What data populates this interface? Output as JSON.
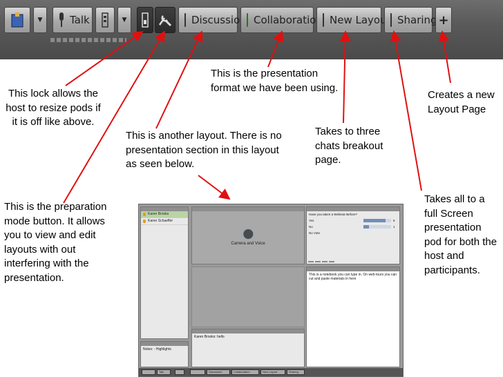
{
  "toolbar": {
    "talk_label": "Talk",
    "tabs": [
      "Discussion",
      "Collaboration",
      "New Layout",
      "Sharing"
    ],
    "active_tab": "Collaboration",
    "add_symbol": "+",
    "icons": {
      "user": "user-icon",
      "mic": "microphone-icon",
      "cam": "camera-icon",
      "lock": "lock-icon",
      "prep": "preparation-mode-icon",
      "dropdown": "dropdown-arrow-icon",
      "add": "plus-icon"
    },
    "colors": {
      "active_indicator": "#3fd13a",
      "toolbar_bg": "#5a5a5a"
    }
  },
  "callouts": {
    "lock": "This lock allows the host to resize pods if it is off like above.",
    "prep": "This is the preparation mode button.  It allows you to view and edit layouts with out interfering with the presentation.",
    "discussion": "This is another layout.  There is no presentation section in this layout as seen below.",
    "collaboration": "This is the presentation format we have been using.",
    "new_layout": "Takes to three chats breakout page.",
    "sharing": "Takes all to a full Screen presentation pod for both the host and participants.",
    "add": "Creates a new Layout Page"
  },
  "screenshot": {
    "attendees": [
      "Karen Brooks",
      "Karen Schaeffer"
    ],
    "camera_label": "Camera and Voice",
    "poll_question": "Have you taken a Webinar Before?",
    "poll_options": [
      {
        "label": "Yes",
        "value": 0.8,
        "count": "5"
      },
      {
        "label": "No",
        "value": 0.2,
        "count": "1"
      },
      {
        "label": "No Vote",
        "value": 0,
        "count": ""
      }
    ],
    "notes_text": "This is a notebook you can type in. On web tours you can cut and paste materials in here",
    "chat_line": "Karen Brooks: hello",
    "notes2": "Notes: - Highlights"
  }
}
